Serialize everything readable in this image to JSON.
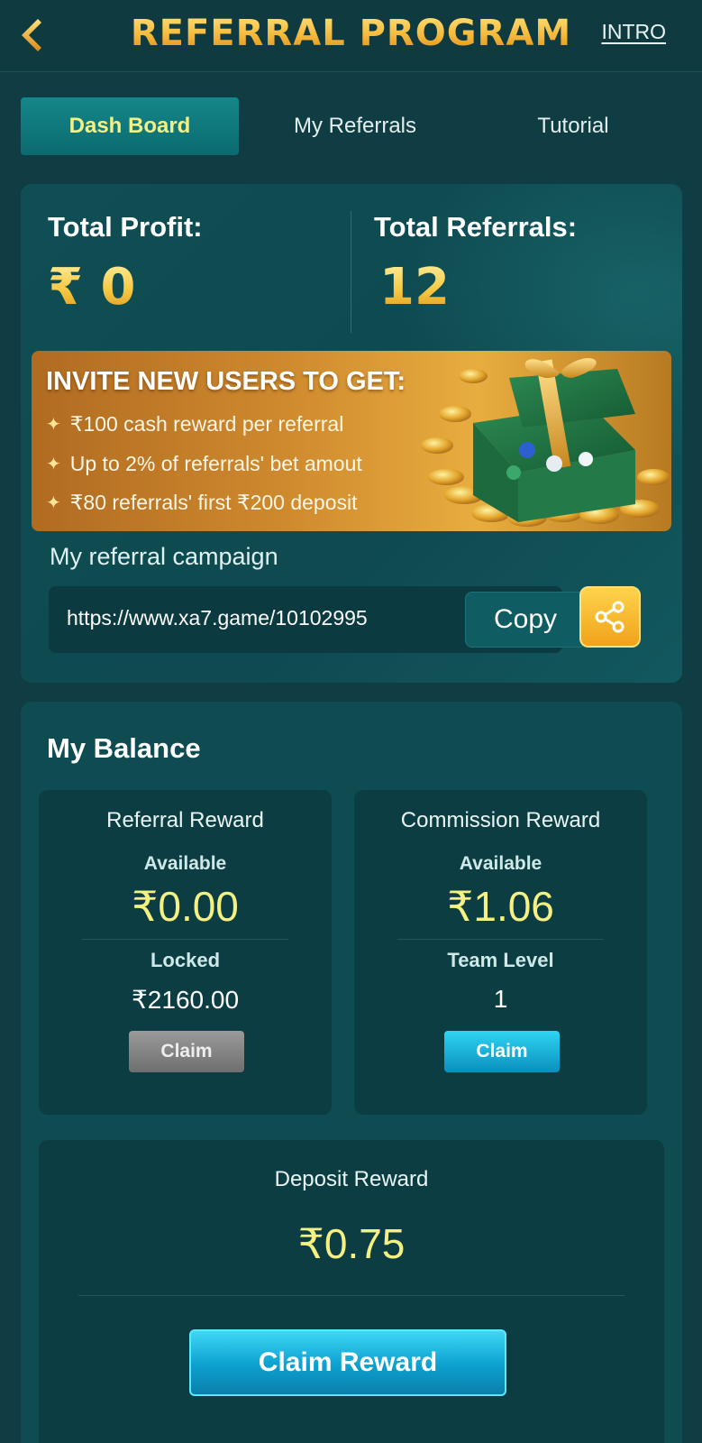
{
  "header": {
    "title": "REFERRAL PROGRAM",
    "intro_label": "INTRO"
  },
  "tabs": [
    {
      "label": "Dash Board",
      "active": true
    },
    {
      "label": "My Referrals",
      "active": false
    },
    {
      "label": "Tutorial",
      "active": false
    }
  ],
  "stats": {
    "total_profit_label": "Total Profit:",
    "total_profit_value": "₹ 0",
    "total_referrals_label": "Total Referrals:",
    "total_referrals_value": "12"
  },
  "invite": {
    "title": "INVITE NEW USERS TO GET:",
    "items": [
      "₹100  cash reward per referral",
      "Up to 2% of referrals' bet amout",
      "₹80 referrals' first ₹200 deposit"
    ]
  },
  "campaign": {
    "label": "My referral campaign",
    "link": "https://www.xa7.game/10102995",
    "copy_label": "Copy"
  },
  "balance": {
    "title": "My Balance",
    "referral_reward": {
      "title": "Referral Reward",
      "available_label": "Available",
      "available_amount": "₹0.00",
      "sub_label": "Locked",
      "sub_value": "₹2160.00",
      "claim_label": "Claim"
    },
    "commission_reward": {
      "title": "Commission Reward",
      "available_label": "Available",
      "available_amount": "₹1.06",
      "sub_label": "Team Level",
      "sub_value": "1",
      "claim_label": "Claim"
    },
    "deposit_reward": {
      "title": "Deposit Reward",
      "amount": "₹0.75",
      "claim_label": "Claim Reward"
    }
  },
  "icons": {
    "back": "back-arrow-icon",
    "share": "share-icon",
    "star": "sparkle-icon",
    "gift": "gift-box-icon"
  },
  "colors": {
    "background": "#0f3d43",
    "accent_gold": "#f5b93a",
    "amount_yellow": "#f4f082",
    "tab_active": "#0b6a6f",
    "claim_blue": "#0c9fcf"
  }
}
